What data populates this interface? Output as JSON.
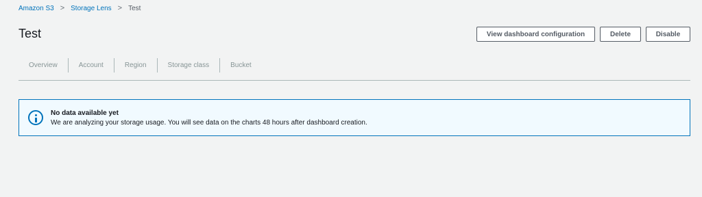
{
  "breadcrumb": {
    "items": [
      "Amazon S3",
      "Storage Lens"
    ],
    "current": "Test"
  },
  "page": {
    "title": "Test"
  },
  "actions": {
    "view_config": "View dashboard configuration",
    "delete": "Delete",
    "disable": "Disable"
  },
  "tabs": [
    "Overview",
    "Account",
    "Region",
    "Storage class",
    "Bucket"
  ],
  "alert": {
    "icon": "info-icon",
    "title": "No data available yet",
    "message": "We are analyzing your storage usage. You will see data on the charts 48 hours after dashboard creation."
  },
  "colors": {
    "background": "#f2f3f3",
    "link": "#0073bb",
    "alert_bg": "#f1faff",
    "alert_border": "#0073bb"
  }
}
